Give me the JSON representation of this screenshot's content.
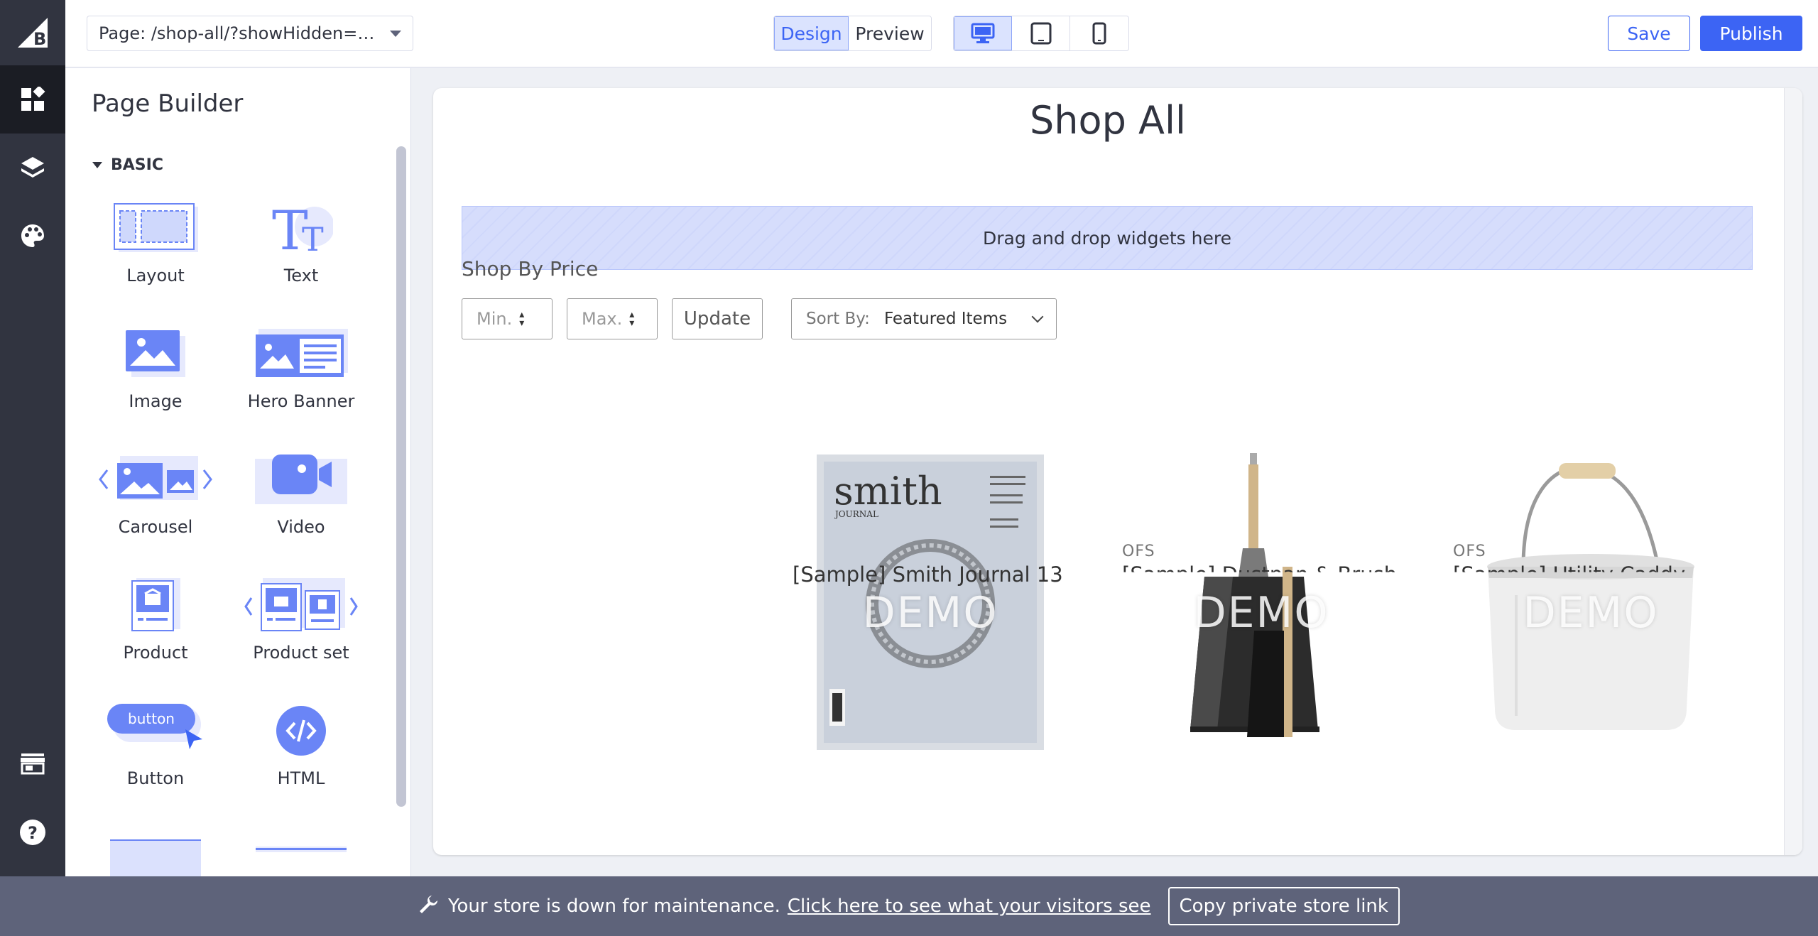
{
  "topbar": {
    "page_select_value": "Page: /shop-all/?showHidden=tr…",
    "mode_design": "Design",
    "mode_preview": "Preview",
    "save_label": "Save",
    "publish_label": "Publish",
    "accent_color": "#3c64f4"
  },
  "sidebar": {
    "title": "Page Builder",
    "section": "BASIC",
    "widgets": [
      "Layout",
      "Text",
      "Image",
      "Hero Banner",
      "Carousel",
      "Video",
      "Product",
      "Product set",
      "Button",
      "HTML"
    ],
    "button_icon_text": "button"
  },
  "canvas": {
    "title": "Shop All",
    "dropzone_text": "Drag and drop widgets here",
    "shop_by_price": "Shop By Price",
    "min_placeholder": "Min.",
    "max_placeholder": "Max.",
    "update_label": "Update",
    "sort_label": "Sort By:",
    "sort_value": "Featured Items",
    "demo_watermark": "DEMO",
    "products": [
      {
        "brand": "",
        "name": "[Sample] Smith Journal 13"
      },
      {
        "brand": "OFS",
        "name": "[Sample] Dustpan & Brush"
      },
      {
        "brand": "OFS",
        "name": "[Sample] Utility Caddy"
      }
    ]
  },
  "footer": {
    "message": "Your store is down for maintenance.",
    "link_text": "Click here to see what your visitors see",
    "copy_button": "Copy private store link"
  }
}
